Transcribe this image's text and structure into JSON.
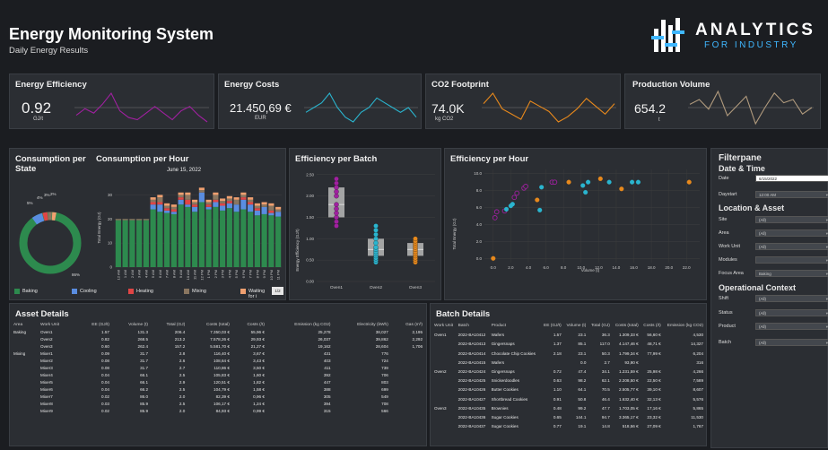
{
  "header": {
    "title": "Energy Monitoring System",
    "subtitle": "Daily Energy Results"
  },
  "logo": {
    "line1": "ANALYTICS",
    "line2": "FOR INDUSTRY"
  },
  "colors": {
    "purple": "#a020a0",
    "cyan": "#2ab5cf",
    "orange": "#e8891c",
    "tan": "#b09a7d",
    "green": "#2d8a4e",
    "blue": "#5a8de0",
    "red": "#e04545",
    "brown": "#8a7660",
    "peach": "#f0a070"
  },
  "kpis": [
    {
      "title": "Energy Efficiency",
      "value": "0.92",
      "unit": "GJ/t"
    },
    {
      "title": "Energy Costs",
      "value": "21.450,69 €",
      "unit": "EUR"
    },
    {
      "title": "CO2 Footprint",
      "value": "74.0K",
      "unit": "kg CO2"
    },
    {
      "title": "Production Volume",
      "value": "654.2",
      "unit": "t"
    }
  ],
  "consumption_state": {
    "title": "Consumption per State",
    "labels": [
      "5%",
      "4%",
      "3%",
      "2%",
      "86%"
    ]
  },
  "consumption_hour": {
    "title": "Consumption per Hour",
    "date": "June 15, 2022",
    "ylabel": "Total Energy (GJ)",
    "yticks": [
      "0",
      "10",
      "20",
      "30"
    ],
    "hours": [
      "12 AM",
      "1 AM",
      "2 AM",
      "3 AM",
      "4 AM",
      "5 AM",
      "6 AM",
      "7 AM",
      "8 AM",
      "9 AM",
      "10 AM",
      "11 AM",
      "12 PM",
      "1 PM",
      "2 PM",
      "3 PM",
      "4 PM",
      "5 PM",
      "6 PM",
      "7 PM",
      "8 PM",
      "9 PM",
      "10 PM",
      "11 PM"
    ]
  },
  "legend": {
    "items": [
      "Baking",
      "Cooling",
      "Heating",
      "Mixing",
      "Waiting for i"
    ],
    "page": "1/2"
  },
  "eff_batch": {
    "title": "Efficiency per Batch",
    "ylabel": "Energy Efficiency (GJ/t)",
    "yticks": [
      "0.00",
      "0.50",
      "1.00",
      "1.50",
      "2.00",
      "2.50"
    ],
    "categories": [
      "Oven1",
      "Oven2",
      "Oven3"
    ]
  },
  "eff_hour": {
    "title": "Efficiency per Hour",
    "ylabel": "Total Energy (GJ)",
    "xlabel": "Volume (t)",
    "yticks": [
      "0.0",
      "2.0",
      "4.0",
      "6.0",
      "8.0",
      "10.0"
    ],
    "xticks": [
      "0.0",
      "2.0",
      "4.0",
      "6.0",
      "8.0",
      "10.0",
      "12.0",
      "14.0",
      "16.0",
      "18.0",
      "20.0",
      "22.0"
    ]
  },
  "chart_data": [
    {
      "type": "line",
      "title": "Energy Efficiency",
      "values": [
        0.92,
        0.95,
        0.93,
        0.97,
        1.02,
        0.94,
        0.91,
        0.9,
        0.93,
        0.96,
        0.93,
        0.9,
        0.94,
        0.96,
        0.92,
        0.89
      ]
    },
    {
      "type": "line",
      "title": "Energy Costs",
      "values": [
        21,
        22,
        23,
        25,
        22,
        20,
        19,
        21,
        22,
        24,
        23,
        22,
        21,
        22,
        20
      ]
    },
    {
      "type": "line",
      "title": "CO2 Footprint",
      "values": [
        74,
        78,
        72,
        70,
        68,
        75,
        73,
        71,
        67,
        69,
        72,
        76,
        73,
        70,
        74
      ]
    },
    {
      "type": "line",
      "title": "Production Volume",
      "values": [
        654,
        660,
        648,
        670,
        640,
        652,
        664,
        630,
        650,
        668,
        656,
        660,
        642,
        650
      ]
    },
    {
      "type": "bar",
      "title": "Consumption per Hour",
      "categories": [
        "12 AM",
        "1 AM",
        "2 AM",
        "3 AM",
        "4 AM",
        "5 AM",
        "6 AM",
        "7 AM",
        "8 AM",
        "9 AM",
        "10 AM",
        "11 AM",
        "12 PM",
        "1 PM",
        "2 PM",
        "3 PM",
        "4 PM",
        "5 PM",
        "6 PM",
        "7 PM",
        "8 PM",
        "9 PM",
        "10 PM",
        "11 PM"
      ],
      "ylim": [
        0,
        35
      ],
      "series": [
        {
          "name": "Baking",
          "values": [
            19.5,
            19.5,
            19.5,
            19.5,
            19.5,
            24,
            23,
            22.5,
            22,
            26,
            25,
            23,
            27,
            24,
            25,
            23.5,
            24.5,
            23,
            24,
            23,
            21.5,
            22,
            21.5,
            21
          ]
        },
        {
          "name": "Cooling",
          "values": [
            0,
            0,
            0,
            0,
            0,
            2,
            3,
            1,
            1,
            2,
            1,
            2,
            4,
            1,
            2,
            2,
            2,
            3,
            4,
            3,
            2,
            3,
            1,
            2
          ]
        },
        {
          "name": "Heating",
          "values": [
            0,
            0,
            0,
            0,
            0,
            1,
            1,
            1,
            1,
            1,
            2,
            1,
            0,
            1,
            1,
            1,
            1,
            0,
            1,
            1,
            1,
            0,
            1,
            0
          ]
        },
        {
          "name": "Mixing",
          "values": [
            0.5,
            0.5,
            0.5,
            0.5,
            0.5,
            1,
            2,
            1,
            1,
            1,
            2,
            1,
            1,
            1,
            2,
            1,
            1,
            2,
            1,
            1,
            1,
            1,
            2,
            1
          ]
        },
        {
          "name": "Waiting for i",
          "values": [
            0,
            0,
            0,
            0,
            0,
            1,
            1,
            1,
            1,
            1,
            1,
            1,
            1,
            1,
            1,
            1,
            1,
            1,
            1,
            1,
            1,
            1,
            1,
            1
          ]
        }
      ]
    },
    {
      "type": "scatter",
      "title": "Efficiency per Batch",
      "categories": [
        "Oven1",
        "Oven2",
        "Oven3"
      ],
      "ylim": [
        0,
        2.6
      ],
      "series": [
        {
          "name": "Oven1",
          "values": [
            1.3,
            1.4,
            1.5,
            1.6,
            1.7,
            1.8,
            2.0,
            2.1,
            2.2,
            2.3,
            2.4
          ]
        },
        {
          "name": "Oven2",
          "values": [
            0.45,
            0.5,
            0.55,
            0.6,
            0.65,
            0.7,
            0.75,
            0.8,
            0.9,
            1.0,
            1.1,
            1.2,
            1.3
          ]
        },
        {
          "name": "Oven3",
          "values": [
            0.45,
            0.5,
            0.55,
            0.6,
            0.65,
            0.7,
            0.75,
            0.8,
            0.85,
            0.9,
            0.95,
            1.0
          ]
        }
      ]
    },
    {
      "type": "scatter",
      "title": "Efficiency per Hour",
      "xlabel": "Volume (t)",
      "ylabel": "Total Energy (GJ)",
      "xlim": [
        -1,
        23.5
      ],
      "ylim": [
        -0.5,
        10.5
      ],
      "points": [
        {
          "x": 0,
          "y": 0,
          "c": "orange"
        },
        {
          "x": 0.2,
          "y": 4.8,
          "c": "purple"
        },
        {
          "x": 0.4,
          "y": 5.5,
          "c": "purple"
        },
        {
          "x": 1.3,
          "y": 5.6,
          "c": "purple"
        },
        {
          "x": 1.5,
          "y": 5.8,
          "c": "cyan"
        },
        {
          "x": 2.0,
          "y": 6.2,
          "c": "cyan"
        },
        {
          "x": 2.2,
          "y": 6.4,
          "c": "cyan"
        },
        {
          "x": 2.4,
          "y": 7.2,
          "c": "purple"
        },
        {
          "x": 2.7,
          "y": 7.7,
          "c": "purple"
        },
        {
          "x": 3.5,
          "y": 8.3,
          "c": "purple"
        },
        {
          "x": 3.7,
          "y": 8.5,
          "c": "purple"
        },
        {
          "x": 5.0,
          "y": 6.9,
          "c": "orange"
        },
        {
          "x": 5.3,
          "y": 5.7,
          "c": "cyan"
        },
        {
          "x": 5.5,
          "y": 8.4,
          "c": "cyan"
        },
        {
          "x": 6.7,
          "y": 9.0,
          "c": "purple"
        },
        {
          "x": 7.0,
          "y": 9.0,
          "c": "purple"
        },
        {
          "x": 8.6,
          "y": 9.0,
          "c": "orange"
        },
        {
          "x": 10.2,
          "y": 8.6,
          "c": "cyan"
        },
        {
          "x": 10.5,
          "y": 7.8,
          "c": "cyan"
        },
        {
          "x": 10.8,
          "y": 9.0,
          "c": "cyan"
        },
        {
          "x": 12.2,
          "y": 9.4,
          "c": "orange"
        },
        {
          "x": 13.2,
          "y": 9.0,
          "c": "cyan"
        },
        {
          "x": 14.6,
          "y": 8.2,
          "c": "orange"
        },
        {
          "x": 15.8,
          "y": 9.0,
          "c": "cyan"
        },
        {
          "x": 16.5,
          "y": 9.0,
          "c": "cyan"
        },
        {
          "x": 22.3,
          "y": 9.0,
          "c": "orange"
        }
      ]
    }
  ],
  "filterpane": {
    "title": "Filterpane",
    "date_section": "Date & Time",
    "date_label": "Date",
    "date_value": "6/15/2022",
    "daystart_label": "Daystart",
    "daystart_value": "12:00 AM",
    "loc_section": "Location & Asset",
    "loc_fields": [
      {
        "label": "Site",
        "value": "(All)"
      },
      {
        "label": "Area",
        "value": "(All)"
      },
      {
        "label": "Work Unit",
        "value": "(All)"
      },
      {
        "label": "Modules",
        "value": ""
      },
      {
        "label": "Focus Area",
        "value": "Baking"
      }
    ],
    "op_section": "Operational Context",
    "op_fields": [
      {
        "label": "Shift",
        "value": "(All)"
      },
      {
        "label": "Status",
        "value": "(All)"
      },
      {
        "label": "Product",
        "value": "(All)"
      },
      {
        "label": "Batch",
        "value": "(All)"
      }
    ]
  },
  "asset": {
    "title": "Asset Details",
    "headers": [
      "Area",
      "Work Unit",
      "EE (GJ/t)",
      "Volume (t)",
      "Total (GJ)",
      "Costs (total)",
      "Costs (/t)",
      "Emission (kg CO2)",
      "Electricity (kWh)",
      "Gas (m³)"
    ],
    "rows": [
      [
        "Baking",
        "Oven1",
        "1.57",
        "131.3",
        "206.4",
        "7.350,03 €",
        "55,96 €",
        "25,278",
        "38,027",
        "2,195"
      ],
      [
        "",
        "Oven2",
        "0.82",
        "268.5",
        "213.2",
        "7.578,26 €",
        "29,93 €",
        "26,037",
        "39,862",
        "2,292"
      ],
      [
        "",
        "Oven3",
        "0.60",
        "262.4",
        "157.2",
        "5.581,70 €",
        "21,27 €",
        "19,162",
        "28,604",
        "1,706"
      ],
      [
        "Mixing",
        "Mixer1",
        "0.09",
        "31.7",
        "2.8",
        "116,40 €",
        "3,67 €",
        "431",
        "776",
        ""
      ],
      [
        "",
        "Mixer2",
        "0.08",
        "31.7",
        "2.6",
        "108,64 €",
        "3,43 €",
        "403",
        "724",
        ""
      ],
      [
        "",
        "Mixer3",
        "0.08",
        "31.7",
        "2.7",
        "110,86 €",
        "3,50 €",
        "411",
        "739",
        ""
      ],
      [
        "",
        "Mixer4",
        "0.04",
        "66.1",
        "2.5",
        "105,83 €",
        "1,60 €",
        "392",
        "706",
        ""
      ],
      [
        "",
        "Mixer5",
        "0.04",
        "66.1",
        "2.9",
        "120,51 €",
        "1,82 €",
        "447",
        "803",
        ""
      ],
      [
        "",
        "Mixer6",
        "0.04",
        "66.2",
        "2.5",
        "104,79 €",
        "1,58 €",
        "388",
        "699",
        ""
      ],
      [
        "",
        "Mixer7",
        "0.02",
        "86.0",
        "2.0",
        "82,39 €",
        "0,96 €",
        "305",
        "549",
        ""
      ],
      [
        "",
        "Mixer8",
        "0.03",
        "85.9",
        "2.5",
        "106,17 €",
        "1,24 €",
        "394",
        "708",
        ""
      ],
      [
        "",
        "Mixer9",
        "0.02",
        "85.9",
        "2.0",
        "84,93 €",
        "0,99 €",
        "315",
        "566",
        ""
      ]
    ]
  },
  "batch": {
    "title": "Batch Details",
    "headers": [
      "Work Unit",
      "Batch",
      "Product",
      "EE (GJ/t)",
      "Volume (t)",
      "Total (GJ)",
      "Costs (total)",
      "Costs (/t)",
      "Emission (kg CO2)"
    ],
    "rows": [
      [
        "Oven1",
        "2022-BA10412",
        "Wafers",
        "1.57",
        "23.1",
        "36.3",
        "1.309,33 €",
        "56,60 €",
        "4,530"
      ],
      [
        "",
        "2022-BA10413",
        "Gingersnaps",
        "1.37",
        "85.1",
        "117.0",
        "4.147,46 €",
        "48,71 €",
        "14,327"
      ],
      [
        "",
        "2022-BA10414",
        "Chocolate Chip Cookies",
        "2.18",
        "23.1",
        "50.3",
        "1.799,34 €",
        "77,99 €",
        "6,204"
      ],
      [
        "",
        "2022-BA10415",
        "Wafers",
        "",
        "0.0",
        "2.7",
        "93,90 €",
        "",
        "316"
      ],
      [
        "Oven2",
        "2022-BA10424",
        "Gingersnaps",
        "0.72",
        "47.4",
        "34.1",
        "1.231,59 €",
        "25,98 €",
        "4,266"
      ],
      [
        "",
        "2022-BA10425",
        "Snickerdoodles",
        "0.63",
        "98.2",
        "62.1",
        "2.208,50 €",
        "22,50 €",
        "7,589"
      ],
      [
        "",
        "2022-BA10426",
        "Butter Cookies",
        "1.10",
        "64.1",
        "70.5",
        "2.505,77 €",
        "39,10 €",
        "8,607"
      ],
      [
        "",
        "2022-BA10427",
        "Shortbread Cookies",
        "0.91",
        "50.8",
        "46.4",
        "1.632,40 €",
        "32,13 €",
        "5,576"
      ],
      [
        "Oven3",
        "2022-BA10435",
        "Brownies",
        "0.48",
        "99.2",
        "47.7",
        "1.703,05 €",
        "17,16 €",
        "5,865"
      ],
      [
        "",
        "2022-BA10436",
        "Sugar Cookies",
        "0.65",
        "144.1",
        "94.7",
        "3.365,17 €",
        "23,32 €",
        "11,530"
      ],
      [
        "",
        "2022-BA10437",
        "Sugar Cookies",
        "0.77",
        "19.1",
        "14.8",
        "518,56 €",
        "27,09 €",
        "1,767"
      ]
    ]
  }
}
